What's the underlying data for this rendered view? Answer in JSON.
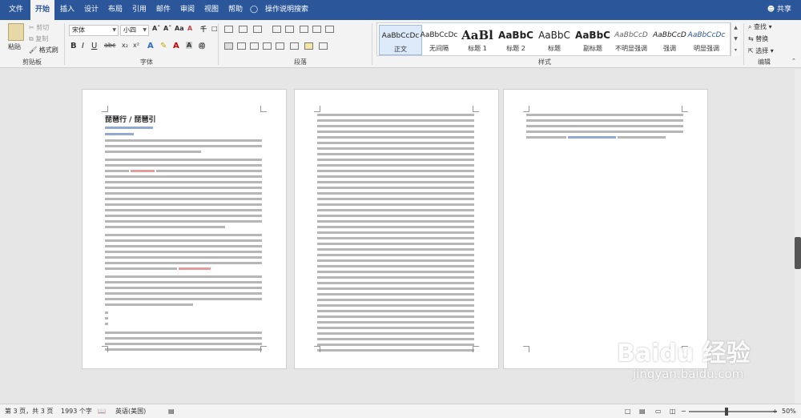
{
  "tabs": [
    "文件",
    "开始",
    "插入",
    "设计",
    "布局",
    "引用",
    "邮件",
    "审阅",
    "视图",
    "帮助"
  ],
  "active_tab": "开始",
  "tell_me": "操作说明搜索",
  "share": "共享",
  "clipboard": {
    "paste": "粘贴",
    "cut": "剪切",
    "copy": "复制",
    "format_painter": "格式刷",
    "label": "剪贴板"
  },
  "font": {
    "name": "宋体",
    "size": "小四",
    "label": "字体"
  },
  "paragraph": {
    "label": "段落"
  },
  "styles": {
    "label": "样式",
    "items": [
      {
        "sample": "AaBbCcDc",
        "name": "正文"
      },
      {
        "sample": "AaBbCcDc",
        "name": "无间隔"
      },
      {
        "sample": "AaBl",
        "name": "标题 1"
      },
      {
        "sample": "AaBbC",
        "name": "标题 2"
      },
      {
        "sample": "AaBbC",
        "name": "标题"
      },
      {
        "sample": "AaBbC",
        "name": "副标题"
      },
      {
        "sample": "AaBbCcD",
        "name": "不明显强调"
      },
      {
        "sample": "AaBbCcD",
        "name": "强调"
      },
      {
        "sample": "AaBbCcDc",
        "name": "明显强调"
      }
    ]
  },
  "editing": {
    "find": "查找",
    "replace": "替换",
    "select": "选择",
    "label": "编辑"
  },
  "document": {
    "title": "琵琶行 / 琵琶引"
  },
  "status": {
    "page": "第 3 页，共 3 页",
    "words": "1993 个字",
    "language": "英语(美国)",
    "zoom": "50%"
  },
  "watermark": {
    "brand": "Baidu 经验",
    "url": "jingyan.baidu.com"
  }
}
